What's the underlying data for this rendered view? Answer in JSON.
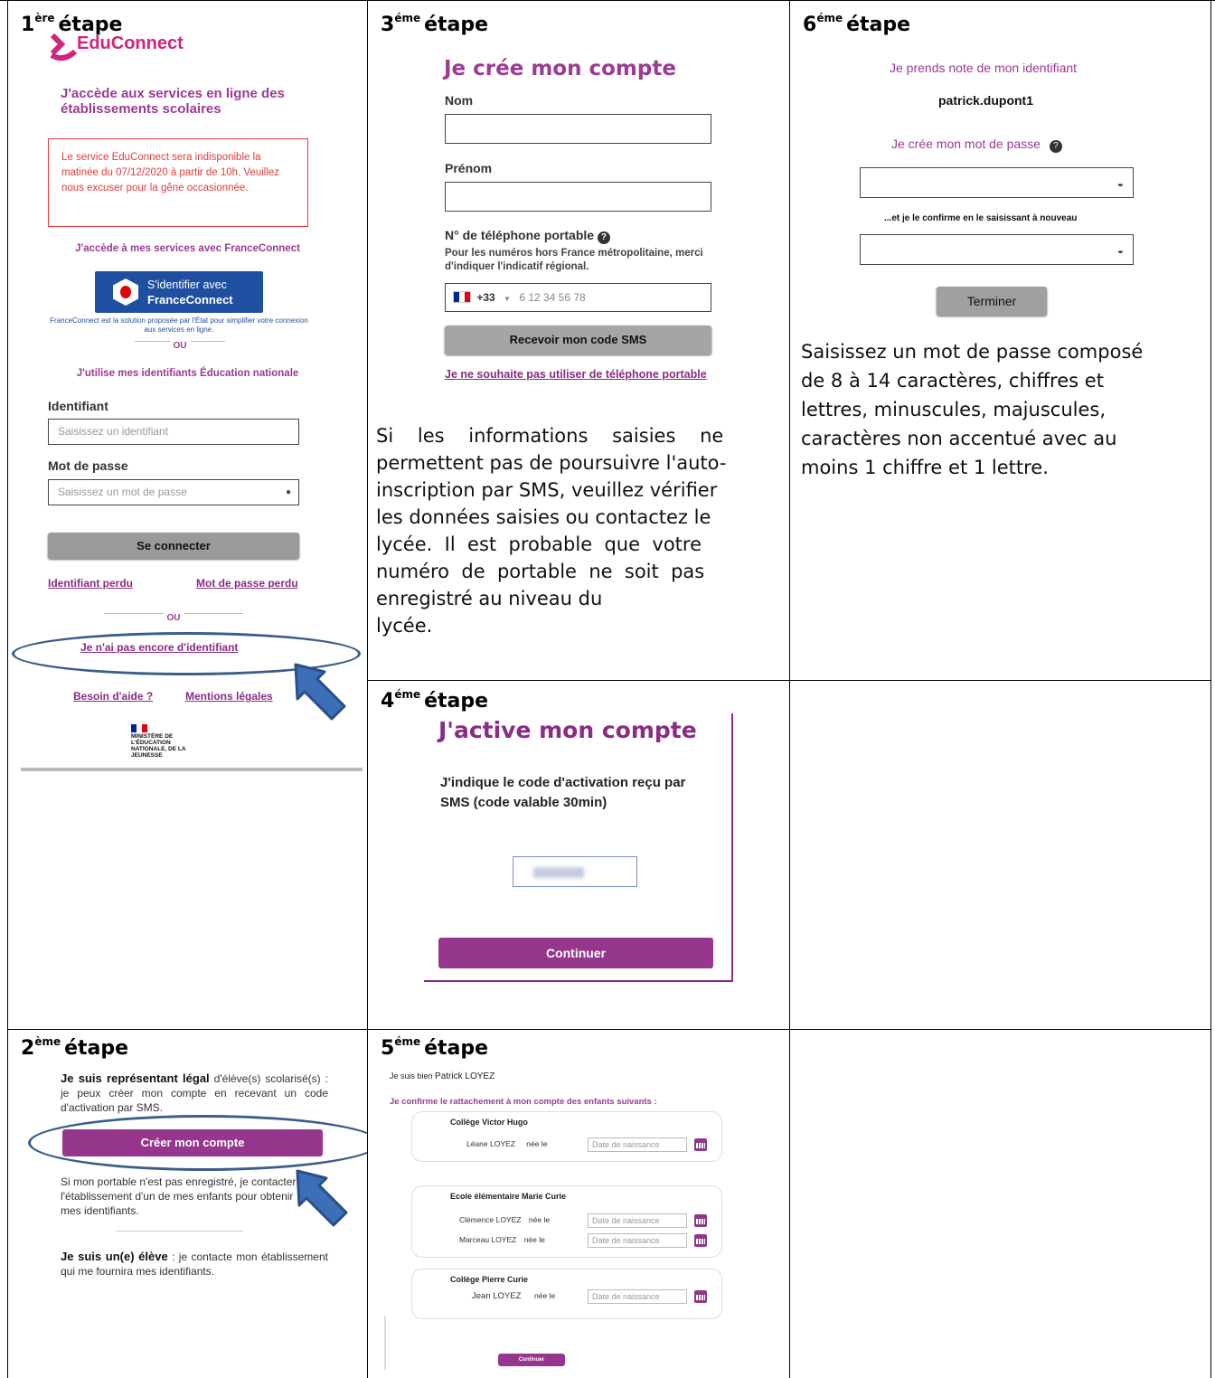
{
  "step1": {
    "title_num": "1",
    "title_sup": "ère",
    "title_word": "étape",
    "logo_text": "EduConnect",
    "heading": "J'accède aux services en ligne des établissements scolaires",
    "alert": "Le service EduConnect sera indisponible la matinée du 07/12/2020 à partir de 10h. Veuillez nous excuser pour la gêne occasionnée.",
    "fc_heading": "J'accède à mes services avec FranceConnect",
    "fc_button_line1": "S'identifier avec",
    "fc_button_line2": "FranceConnect",
    "fc_caption": "FranceConnect est la solution proposée par l'État pour simplifier votre connexion aux services en ligne.",
    "ou1": "OU",
    "en_heading": "J'utilise mes identifiants Éducation nationale",
    "id_label": "Identifiant",
    "id_placeholder": "Saisissez un identifiant",
    "pw_label": "Mot de passe",
    "pw_placeholder": "Saisissez un mot de passe",
    "connect_button": "Se connecter",
    "lost_id": "Identifiant perdu",
    "lost_pw": "Mot de passe perdu",
    "ou2": "OU",
    "no_id_link": "Je n'ai pas encore d'identifiant",
    "help_link": "Besoin d'aide ?",
    "legal_link": "Mentions légales",
    "ministry": "MINISTÈRE DE L'ÉDUCATION NATIONALE, DE LA JEUNESSE"
  },
  "step2": {
    "title_num": "2",
    "title_sup": "ème",
    "title_word": "étape",
    "p1_bold1": "Je suis représentant légal",
    "p1_rest": " d'élève(s) scolarisé(s) : je peux créer mon compte en recevant un code d'activation par SMS.",
    "create_button": "Créer mon compte",
    "p2": "Si mon portable n'est pas enregistré, je contacter l'établissement d'un de mes enfants pour obtenir mes identifiants.",
    "p3_bold": "Je suis un(e) élève",
    "p3_rest": " : je contacte mon établissement qui me fournira mes identifiants."
  },
  "step3": {
    "title_num": "3",
    "title_sup": "éme",
    "title_word": "étape",
    "heading": "Je crée mon compte",
    "nom_label": "Nom",
    "prenom_label": "Prénom",
    "phone_label": "N° de téléphone portable",
    "phone_hint": "Pour les numéros hors France métropolitaine, merci d'indiquer l'indicatif régional.",
    "phone_prefix": "+33",
    "phone_placeholder": "6 12 34 56 78",
    "sms_button": "Recevoir mon code SMS",
    "no_phone_link": "Je ne souhaite pas utiliser de téléphone portable",
    "note_lines": [
      "Si    les    informations    saisies    ne",
      "permettent pas de poursuivre l'auto-",
      "inscription par SMS, veuillez vérifier",
      "les données saisies ou contactez le",
      "lycée.  Il  est  probable  que  votre",
      "numéro  de  portable  ne  soit  pas",
      "enregistré au niveau du",
      "lycée."
    ]
  },
  "step4": {
    "title_num": "4",
    "title_sup": "éme",
    "title_word": "étape",
    "heading": "J'active mon compte",
    "instruction": "J'indique le code d'activation reçu par SMS (code valable 30min)",
    "continue_button": "Continuer"
  },
  "step5": {
    "title_num": "5",
    "title_sup": "éme",
    "title_word": "étape",
    "intro_prefix": "Je suis bien",
    "intro_name": "Patrick LOYEZ",
    "confirm_heading": "Je confirme le rattachement à mon compte des enfants suivants :",
    "schools": [
      {
        "name": "Collège Victor Hugo",
        "children": [
          {
            "first": "Léane",
            "last": "LOYEZ"
          }
        ]
      },
      {
        "name": "Ecole élémentaire Marie Curie",
        "children": [
          {
            "first": "Clémence",
            "last": "LOYEZ"
          },
          {
            "first": "Marceau",
            "last": "LOYEZ"
          }
        ]
      },
      {
        "name": "Collège Pierre Curie",
        "children": [
          {
            "first": "Jean",
            "last": "LOYEZ"
          }
        ]
      }
    ],
    "born_label": "née le",
    "date_placeholder": "Date de naissance",
    "continue_button": "Continuer"
  },
  "step6": {
    "title_num": "6",
    "title_sup": "éme",
    "title_word": "étape",
    "note_id": "Je prends note de mon identifiant",
    "identifier": "patrick.dupont1",
    "create_pw": "Je crée mon mot de passe",
    "confirm_pw": "...et je le confirme en le saisissant à nouveau",
    "finish_button": "Terminer",
    "rules_lines": [
      "Saisissez un mot de passe composé",
      "de 8 à 14 caractères, chiffres et",
      "lettres, minuscules, majuscules,",
      "caractères non accentué avec au",
      "moins 1 chiffre et 1 lettre."
    ]
  }
}
